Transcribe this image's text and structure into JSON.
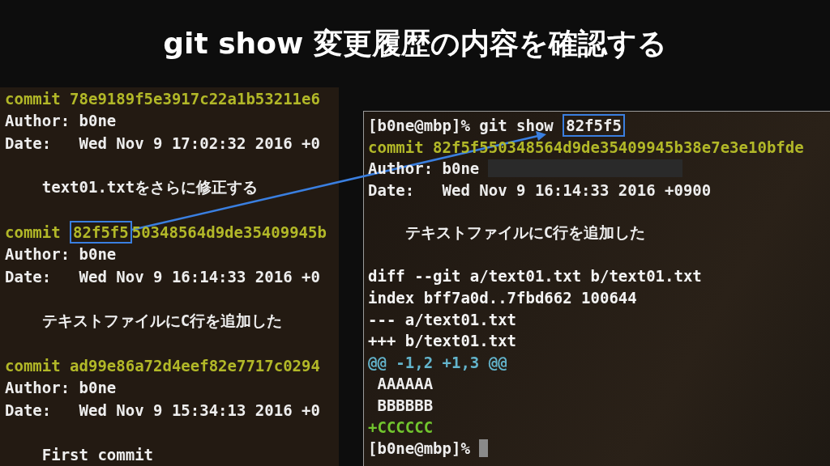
{
  "title": "git show 変更履歴の内容を確認する",
  "log_terminal": {
    "lines": [
      {
        "kind": "commit",
        "parts": [
          {
            "text": "commit 78e9189f5e3917c22a1b53211e6",
            "highlighted": false
          }
        ]
      },
      {
        "kind": "plain",
        "parts": [
          {
            "text": "Author: b0ne",
            "highlighted": false
          }
        ]
      },
      {
        "kind": "plain",
        "parts": [
          {
            "text": "Date:   Wed Nov 9 17:02:32 2016 +0",
            "highlighted": false
          }
        ]
      },
      {
        "kind": "blank"
      },
      {
        "kind": "plain",
        "parts": [
          {
            "text": "    text01.txtをさらに修正する",
            "highlighted": false
          }
        ]
      },
      {
        "kind": "blank"
      },
      {
        "kind": "commit",
        "parts": [
          {
            "text": "commit ",
            "highlighted": false
          },
          {
            "text": "82f5f5",
            "highlighted": true
          },
          {
            "text": "50348564d9de35409945b",
            "highlighted": false
          }
        ]
      },
      {
        "kind": "plain",
        "parts": [
          {
            "text": "Author: b0ne",
            "highlighted": false
          }
        ]
      },
      {
        "kind": "plain",
        "parts": [
          {
            "text": "Date:   Wed Nov 9 16:14:33 2016 +0",
            "highlighted": false
          }
        ]
      },
      {
        "kind": "blank"
      },
      {
        "kind": "plain",
        "parts": [
          {
            "text": "    テキストファイルにC行を追加した",
            "highlighted": false
          }
        ]
      },
      {
        "kind": "blank"
      },
      {
        "kind": "commit",
        "parts": [
          {
            "text": "commit ad99e86a72d4eef82e7717c0294",
            "highlighted": false
          }
        ]
      },
      {
        "kind": "plain",
        "parts": [
          {
            "text": "Author: b0ne",
            "highlighted": false
          }
        ]
      },
      {
        "kind": "plain",
        "parts": [
          {
            "text": "Date:   Wed Nov 9 15:34:13 2016 +0",
            "highlighted": false
          }
        ]
      },
      {
        "kind": "blank"
      },
      {
        "kind": "plain",
        "parts": [
          {
            "text": "    First commit",
            "highlighted": false
          }
        ]
      }
    ]
  },
  "show_terminal": {
    "lines": [
      {
        "kind": "plain",
        "parts": [
          {
            "text": "[b0ne@mbp]% git show ",
            "highlighted": false
          },
          {
            "text": "82f5f5",
            "highlighted": true
          }
        ]
      },
      {
        "kind": "commit",
        "parts": [
          {
            "text": "commit 82f5f550348564d9de35409945b38e7e3e10bfde",
            "highlighted": false
          }
        ]
      },
      {
        "kind": "plain",
        "redacted": true,
        "parts": [
          {
            "text": "Author: b0ne",
            "highlighted": false
          }
        ]
      },
      {
        "kind": "plain",
        "parts": [
          {
            "text": "Date:   Wed Nov 9 16:14:33 2016 +0900",
            "highlighted": false
          }
        ]
      },
      {
        "kind": "blank"
      },
      {
        "kind": "plain",
        "parts": [
          {
            "text": "    テキストファイルにC行を追加した",
            "highlighted": false
          }
        ]
      },
      {
        "kind": "blank"
      },
      {
        "kind": "meta",
        "parts": [
          {
            "text": "diff --git a/text01.txt b/text01.txt",
            "highlighted": false
          }
        ]
      },
      {
        "kind": "meta",
        "parts": [
          {
            "text": "index bff7a0d..7fbd662 100644",
            "highlighted": false
          }
        ]
      },
      {
        "kind": "meta",
        "parts": [
          {
            "text": "--- a/text01.txt",
            "highlighted": false
          }
        ]
      },
      {
        "kind": "meta",
        "parts": [
          {
            "text": "+++ b/text01.txt",
            "highlighted": false
          }
        ]
      },
      {
        "kind": "hunk",
        "parts": [
          {
            "text": "@@ -1,2 +1,3 @@",
            "highlighted": false
          }
        ]
      },
      {
        "kind": "plain",
        "parts": [
          {
            "text": " AAAAAA",
            "highlighted": false
          }
        ]
      },
      {
        "kind": "plain",
        "parts": [
          {
            "text": " BBBBBB",
            "highlighted": false
          }
        ]
      },
      {
        "kind": "added",
        "parts": [
          {
            "text": "+CCCCCC",
            "highlighted": false
          }
        ]
      },
      {
        "kind": "plain",
        "cursor": true,
        "parts": [
          {
            "text": "[b0ne@mbp]%",
            "highlighted": false
          }
        ]
      }
    ]
  }
}
